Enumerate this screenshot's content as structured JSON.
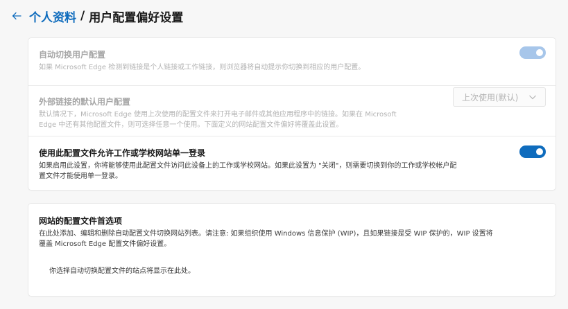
{
  "header": {
    "back_icon": "arrow-left-icon",
    "breadcrumb_parent": "个人资料",
    "separator": "/",
    "title": "用户配置偏好设置"
  },
  "settings": {
    "auto_switch": {
      "title": "自动切换用户配置",
      "description": "如果 Microsoft Edge 检测到链接是个人链接或工作链接，则浏览器将自动提示你切换到相应的用户配置。",
      "state": "on",
      "disabled": true
    },
    "default_profile": {
      "title": "外部链接的默认用户配置",
      "description_line1": "默认情况下，Microsoft Edge 使用上次使用的配置文件来打开电子邮件或其他应用程序中的链接。如果在 Microsoft",
      "description_line2": "Edge 中还有其他配置文件，则可选择任意一个使用。下面定义的网站配置文件偏好将覆盖此设置。",
      "selected_option": "上次使用(默认)",
      "disabled": true
    },
    "sso": {
      "title": "使用此配置文件允许工作或学校网站单一登录",
      "description_line1": "如果启用此设置，你将能够使用此配置文件访问此设备上的工作或学校网站。如果此设置为 \"关闭\"，则需要切换到你的工作或学校帐户配",
      "description_line2": "置文件才能使用单一登录。",
      "state": "on",
      "disabled": false
    }
  },
  "site_preferences": {
    "title": "网站的配置文件首选项",
    "description_line1": "在此处添加、编辑和删除自动配置文件切换网站列表。请注意: 如果组织使用 Windows 信息保护 (WIP)，且如果链接是受 WIP 保护的，WIP 设置将",
    "description_line2": "覆盖 Microsoft Edge 配置文件偏好设置。",
    "empty_text": "你选择自动切换配置文件的站点将显示在此处。"
  },
  "colors": {
    "accent": "#0f6cbd",
    "toggle_disabled": "#a7c6ea",
    "background": "#f7f7f7"
  }
}
